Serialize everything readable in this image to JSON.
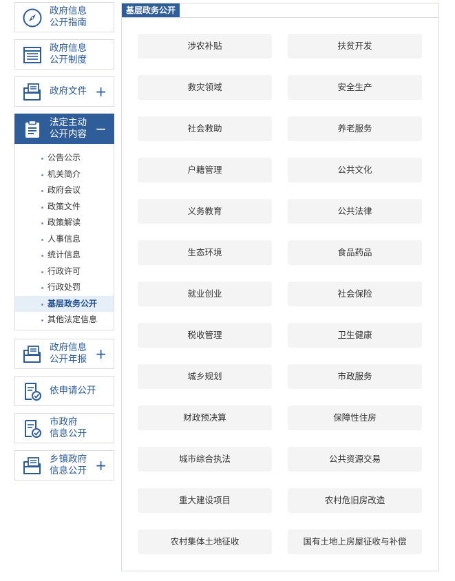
{
  "sidebar": {
    "menu_guide": "政府信息\n公开指南",
    "menu_system": "政府信息\n公开制度",
    "menu_documents": "政府文件",
    "menu_statutory": "法定主动\n公开内容",
    "menu_annual": "政府信息\n公开年报",
    "menu_request": "依申请公开",
    "menu_city": "市政府\n信息公开",
    "menu_towns": "乡镇政府\n信息公开",
    "expand_symbol": "+",
    "collapse_symbol": "−",
    "submenu": [
      "公告公示",
      "机关简介",
      "政府会议",
      "政策文件",
      "政策解读",
      "人事信息",
      "统计信息",
      "行政许可",
      "行政处罚",
      "基层政务公开",
      "其他法定信息"
    ]
  },
  "main": {
    "title": "基层政务公开",
    "categories": [
      "涉农补贴",
      "扶贫开发",
      "救灾领域",
      "安全生产",
      "社会救助",
      "养老服务",
      "户籍管理",
      "公共文化",
      "义务教育",
      "公共法律",
      "生态环境",
      "食品药品",
      "就业创业",
      "社会保险",
      "税收管理",
      "卫生健康",
      "城乡规划",
      "市政服务",
      "财政预决算",
      "保障性住房",
      "城市综合执法",
      "公共资源交易",
      "重大建设项目",
      "农村危旧房改造",
      "农村集体土地征收",
      "国有土地上房屋征收与补偿"
    ]
  },
  "colors": {
    "primary": "#2e5d9a",
    "link": "#2b5a96",
    "button_bg": "#f4f4f4",
    "border": "#d9dde3",
    "highlight": "#e6eef8"
  },
  "icons": {
    "guide": "compass-icon",
    "system": "list-document-icon",
    "documents": "folder-document-icon",
    "statutory": "clipboard-icon",
    "annual": "folder-document-icon",
    "request": "checked-document-icon",
    "city": "checked-document-icon",
    "towns": "folder-document-icon"
  }
}
